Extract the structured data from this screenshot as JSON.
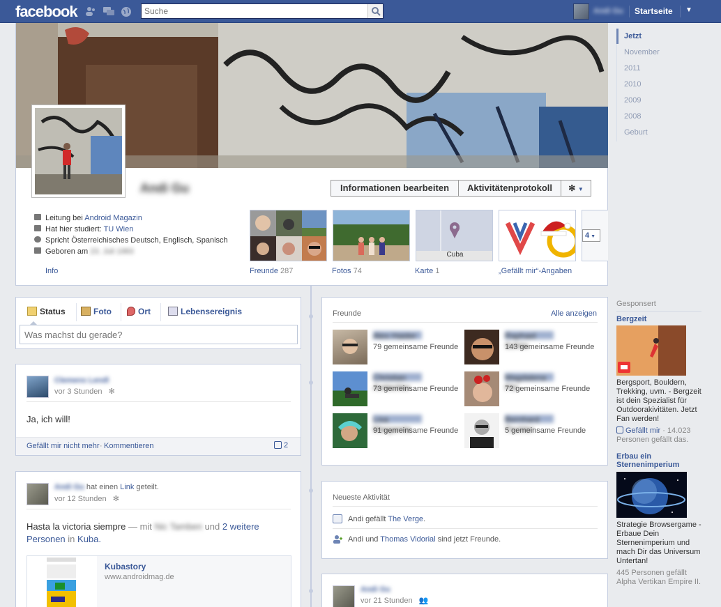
{
  "topbar": {
    "logo": "facebook",
    "search_placeholder": "Suche",
    "home_label": "Startseite",
    "user_name": "Andi Gu"
  },
  "profile": {
    "name": "Andi Gu",
    "edit_button": "Informationen bearbeiten",
    "activity_button": "Aktivitätenprotokoll",
    "info": {
      "work_prefix": "Leitung bei",
      "work_link": "Android Magazin",
      "study_prefix": "Hat hier studiert:",
      "study_link": "TU Wien",
      "languages": "Spricht Österreichisches Deutsch, Englisch, Spanisch",
      "born_prefix": "Geboren am",
      "born_value": "23. Juli 1983"
    },
    "tabs": {
      "info": "Info",
      "friends": "Freunde",
      "friends_count": "287",
      "photos": "Fotos",
      "photos_count": "74",
      "map": "Karte",
      "map_count": "1",
      "likes": "„Gefällt mir“-Angaben",
      "map_place": "Cuba",
      "more_count": "4"
    }
  },
  "timeline_nav": {
    "items": [
      "Jetzt",
      "November",
      "2011",
      "2010",
      "2009",
      "2008",
      "Geburt"
    ]
  },
  "composer": {
    "tabs": [
      "Status",
      "Foto",
      "Ort",
      "Lebensereignis"
    ],
    "placeholder": "Was machst du gerade?"
  },
  "post1": {
    "author": "Clemens Lendl",
    "time": "vor 3 Stunden",
    "text": "Ja, ich will!",
    "unlike": "Gefällt mir nicht mehr",
    "comment": "Kommentieren",
    "like_count": "2",
    "separator": "·"
  },
  "post2": {
    "author": "Andi Gu",
    "action_prefix": "hat einen",
    "action_link": "Link",
    "action_suffix": "geteilt.",
    "time": "vor 12 Stunden",
    "text": "Hasta la victoria siempre",
    "with": "— mit",
    "with_person": "Nic Tamben",
    "and": "und",
    "others_line1": "2 weitere",
    "others_line2": "Personen",
    "in": "in",
    "place": "Kuba.",
    "link_title": "Kubastory",
    "link_url": "www.androidmag.de"
  },
  "friends_box": {
    "title": "Freunde",
    "see_all": "Alle anzeigen",
    "friends": [
      {
        "name": "Alex Haider",
        "mutual": "79 gemeinsame Freunde"
      },
      {
        "name": "Raphael Schön",
        "mutual": "143 gemeinsame Freunde"
      },
      {
        "name": "Christian Ambichler",
        "mutual": "73 gemeinsame Freunde"
      },
      {
        "name": "Magdalena Pilz",
        "mutual": "72 gemeinsame Freunde"
      },
      {
        "name": "Lisa Margareta",
        "mutual": "91 gemeinsame Freunde"
      },
      {
        "name": "Bernhard Tischler",
        "mutual": "5 gemeinsame Freunde"
      }
    ]
  },
  "activity_box": {
    "title": "Neueste Aktivität",
    "line1_prefix": "Andi gefällt",
    "line1_link": "The Verge",
    "line1_suffix": ".",
    "line2_prefix": "Andi und",
    "line2_link": "Thomas Vidorial",
    "line2_suffix": "sind jetzt Freunde."
  },
  "post3": {
    "author": "Andi Gu",
    "time": "vor 21 Stunden"
  },
  "ads": {
    "header": "Gesponsert",
    "ad1": {
      "title": "Bergzeit",
      "text": "Bergsport, Bouldern, Trekking, uvm. - Bergzeit ist dein Spezialist für Outdoorakivitäten. Jetzt Fan werden!",
      "like_link": "Gefällt mir",
      "like_meta": "· 14.023",
      "like_meta2": "Personen gefällt das."
    },
    "ad2": {
      "title_line1": "Erbau ein",
      "title_line2": "Sternenimperium",
      "text": "Strategie Browsergame - Erbaue Dein Sternenimperium und mach Dir das Universum Untertan!",
      "meta": "445 Personen gefällt Alpha Vertikan Empire II."
    }
  },
  "colors": {
    "brand": "#3b5998",
    "background": "#e9ebee",
    "border": "#c4cde0"
  }
}
